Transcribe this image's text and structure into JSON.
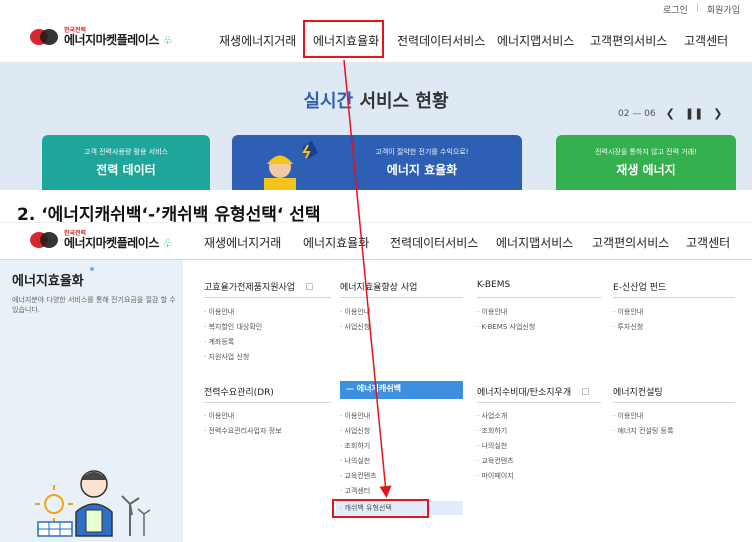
{
  "panel1": {
    "top_links": [
      "로그인",
      "회원가입"
    ],
    "logo": {
      "sub": "한국전력",
      "main": "에너지마켓플레이스"
    },
    "menu": [
      "재생에너지거래",
      "에너지효율화",
      "전력데이터서비스",
      "에너지맵서비스",
      "고객편의서비스",
      "고객센터"
    ],
    "hero": {
      "title_highlight": "실시간",
      "title_rest": " 서비스 현황",
      "pager": "02 — 06",
      "pager_controls": [
        "❮",
        "❚❚",
        "❯"
      ]
    },
    "cards": [
      {
        "small": "고객 전력사용량 활용 서비스",
        "big": "전력 데이터"
      },
      {
        "small": "고객이 절약한 전기를 수익으로!",
        "big": "에너지 효율화"
      },
      {
        "small": "전력시장을 통하지 않고 전력 거래!",
        "big": "재생 에너지"
      }
    ]
  },
  "caption": "2. ‘에너지캐쉬백‘-’캐쉬백 유형선택‘ 선택",
  "panel2": {
    "menu": [
      "재생에너지거래",
      "에너지효율화",
      "전력데이터서비스",
      "에너지맵서비스",
      "고객편의서비스",
      "고객센터"
    ],
    "sidebar": {
      "title": "에너지효율화",
      "desc": "에너지분야 다양한 서비스를 통해 전기요금을 절감 할 수 있습니다."
    },
    "columns": [
      {
        "title": "고효율가전제품지원사업",
        "ext": "☐",
        "items": [
          "이용안내",
          "복지할인 대상확인",
          "계좌등록",
          "지원사업 신청"
        ]
      },
      {
        "title": "에너지효율향상 사업",
        "items": [
          "이용안내",
          "사업신청"
        ]
      },
      {
        "title": "K-BEMS",
        "items": [
          "이용안내",
          "K-BEMS 사업신청"
        ]
      },
      {
        "title": "E-신산업 펀드",
        "items": [
          "이용안내",
          "투자신청"
        ]
      },
      {
        "title": "전력수요관리(DR)",
        "items": [
          "이용안내",
          "전력수요관리사업자 정보"
        ]
      },
      {
        "title": "에너지캐쉬백",
        "items": [
          "이용안내",
          "사업신청",
          "조회하기",
          "나의실천",
          "교육컨텐츠",
          "고객센터",
          "캐쉬백 유형선택"
        ]
      },
      {
        "title": "에너지수비대/탄소지우개",
        "ext": "☐",
        "items": [
          "사업소개",
          "조회하기",
          "나의실천",
          "교육컨텐츠",
          "마이페이지"
        ]
      },
      {
        "title": "에너지컨설팅",
        "items": [
          "이용안내",
          "에너지 컨설팅 등록"
        ]
      }
    ]
  },
  "colors": {
    "accent_blue": "#3d8fe0",
    "annotation_red": "#e3151b",
    "brand_red": "#d8262e",
    "hero_bg": "#dfe9f3"
  }
}
